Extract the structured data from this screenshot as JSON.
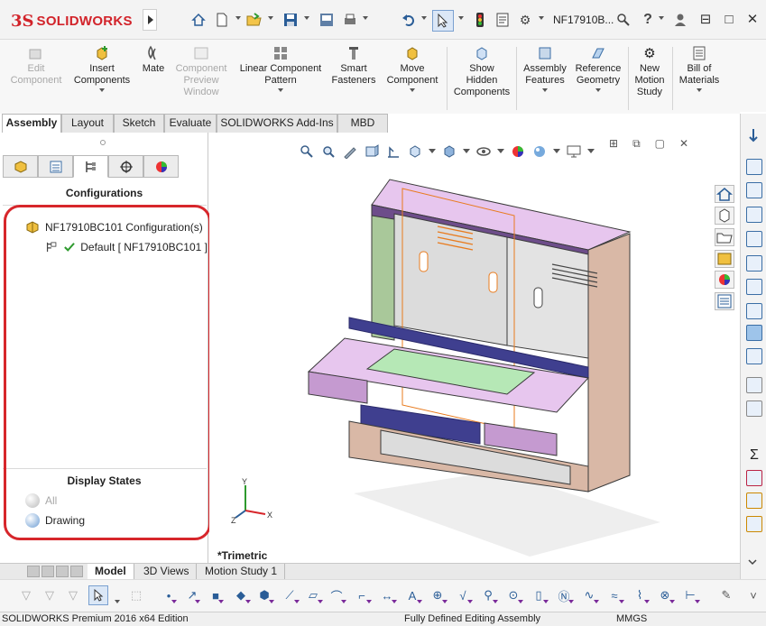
{
  "app": {
    "brand_prefix": "3S",
    "brand_name": "SOLIDWORKS",
    "document_name": "NF17910B...",
    "window_controls": [
      "⊟",
      "□",
      "✕"
    ]
  },
  "title_toolbar": {
    "icons": [
      "home-icon",
      "new-icon",
      "open-icon",
      "save-icon",
      "print-icon",
      "print-preview-icon",
      "undo-icon",
      "select-icon",
      "rebuild-icon",
      "file-properties-icon",
      "options-icon",
      "search-icon",
      "help-icon",
      "user-icon"
    ],
    "help_symbol": "?"
  },
  "command_manager": {
    "buttons": [
      {
        "label": "Edit\nComponent",
        "enabled": false,
        "icon": "edit-component-icon"
      },
      {
        "label": "Insert\nComponents",
        "enabled": true,
        "icon": "insert-components-icon"
      },
      {
        "label": "Mate",
        "enabled": true,
        "icon": "mate-icon"
      },
      {
        "label": "Component\nPreview\nWindow",
        "enabled": false,
        "icon": "component-preview-icon"
      },
      {
        "label": "Linear Component\nPattern",
        "enabled": true,
        "icon": "linear-pattern-icon"
      },
      {
        "label": "Smart\nFasteners",
        "enabled": true,
        "icon": "smart-fasteners-icon"
      },
      {
        "label": "Move\nComponent",
        "enabled": true,
        "icon": "move-component-icon"
      },
      {
        "label": "Show\nHidden\nComponents",
        "enabled": true,
        "icon": "show-hidden-icon"
      },
      {
        "label": "Assembly\nFeatures",
        "enabled": true,
        "icon": "assembly-features-icon"
      },
      {
        "label": "Reference\nGeometry",
        "enabled": true,
        "icon": "reference-geometry-icon"
      },
      {
        "label": "New\nMotion\nStudy",
        "enabled": true,
        "icon": "motion-study-icon"
      },
      {
        "label": "Bill of\nMaterials",
        "enabled": true,
        "icon": "bill-of-materials-icon"
      }
    ]
  },
  "tabs": [
    {
      "label": "Assembly",
      "active": true
    },
    {
      "label": "Layout",
      "active": false
    },
    {
      "label": "Sketch",
      "active": false
    },
    {
      "label": "Evaluate",
      "active": false
    },
    {
      "label": "SOLIDWORKS Add-Ins",
      "active": false
    },
    {
      "label": "MBD",
      "active": false
    }
  ],
  "left_panel": {
    "manager_tabs": [
      "feature-manager-icon",
      "property-manager-icon",
      "configuration-manager-icon",
      "dimxpert-icon",
      "display-manager-icon"
    ],
    "configurations_heading": "Configurations",
    "config_root": "NF17910BC101 Configuration(s)",
    "config_default": "Default [ NF17910BC101 ]",
    "display_states_heading": "Display States",
    "display_states": [
      {
        "label": "All",
        "enabled": false
      },
      {
        "label": "Drawing",
        "enabled": true
      }
    ]
  },
  "viewport": {
    "view_label": "*Trimetric",
    "triad_axes": [
      "Y",
      "X",
      "Z"
    ],
    "colors": {
      "cabinet_lilac": "#e7c6ee",
      "cabinet_side": "#d9b8a6",
      "top_purple": "#6d4d8a",
      "glass_green": "#b6e8b6",
      "inner_panel": "#dcdcdc",
      "outline": "#3a3a3a",
      "drawer_navy": "#3f3f8f",
      "highlight_orange": "#e87b1e"
    }
  },
  "bottom_tabs": [
    {
      "label": "Model",
      "active": true
    },
    {
      "label": "3D Views",
      "active": false
    },
    {
      "label": "Motion Study 1",
      "active": false
    }
  ],
  "status_bar": {
    "left": "SOLIDWORKS Premium 2016 x64 Edition",
    "middle": "Fully Defined   Editing Assembly",
    "units": "MMGS"
  },
  "accent": {
    "highlight_ring": "#d7262b",
    "check_green": "#2e9a2e"
  }
}
